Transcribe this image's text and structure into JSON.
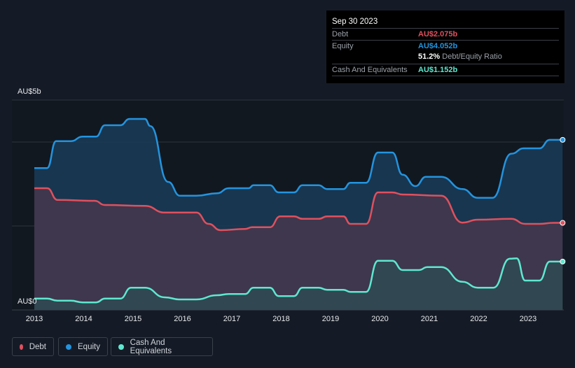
{
  "tooltip": {
    "date": "Sep 30 2023",
    "debt_label": "Debt",
    "debt_value": "AU$2.075b",
    "equity_label": "Equity",
    "equity_value": "AU$4.052b",
    "ratio_value": "51.2%",
    "ratio_label": "Debt/Equity Ratio",
    "cash_label": "Cash And Equivalents",
    "cash_value": "AU$1.152b"
  },
  "legend": [
    {
      "label": "Debt",
      "color": "#e0505e"
    },
    {
      "label": "Equity",
      "color": "#2394df"
    },
    {
      "label": "Cash And Equivalents",
      "color": "#5ee8d0"
    }
  ],
  "chart_data": {
    "type": "area",
    "ylim": [
      0,
      5
    ],
    "y_tick_labels": [
      "AU$0",
      "AU$5b"
    ],
    "x_tick_labels": [
      "2013",
      "2014",
      "2015",
      "2016",
      "2017",
      "2018",
      "2019",
      "2020",
      "2021",
      "2022",
      "2023"
    ],
    "xlim": [
      2013,
      2023.7
    ],
    "series": [
      {
        "name": "Equity",
        "color": "#2394df",
        "points": [
          [
            2013,
            3.38
          ],
          [
            2013.26,
            3.38
          ],
          [
            2013.44,
            4.02
          ],
          [
            2013.74,
            4.02
          ],
          [
            2013.98,
            4.13
          ],
          [
            2014.25,
            4.13
          ],
          [
            2014.43,
            4.4
          ],
          [
            2014.74,
            4.4
          ],
          [
            2014.93,
            4.55
          ],
          [
            2015.24,
            4.55
          ],
          [
            2015.35,
            4.38
          ],
          [
            2015.71,
            3.05
          ],
          [
            2015.95,
            2.72
          ],
          [
            2016.28,
            2.72
          ],
          [
            2016.7,
            2.78
          ],
          [
            2016.94,
            2.9
          ],
          [
            2017.34,
            2.9
          ],
          [
            2017.44,
            2.97
          ],
          [
            2017.77,
            2.97
          ],
          [
            2017.95,
            2.8
          ],
          [
            2018.26,
            2.8
          ],
          [
            2018.43,
            2.97
          ],
          [
            2018.76,
            2.97
          ],
          [
            2018.93,
            2.88
          ],
          [
            2019.26,
            2.88
          ],
          [
            2019.4,
            3.03
          ],
          [
            2019.72,
            3.03
          ],
          [
            2019.96,
            3.75
          ],
          [
            2020.25,
            3.75
          ],
          [
            2020.46,
            3.22
          ],
          [
            2020.72,
            2.95
          ],
          [
            2020.93,
            3.17
          ],
          [
            2021.24,
            3.17
          ],
          [
            2021.67,
            2.88
          ],
          [
            2021.98,
            2.67
          ],
          [
            2022.28,
            2.67
          ],
          [
            2022.66,
            3.72
          ],
          [
            2022.91,
            3.85
          ],
          [
            2023.23,
            3.85
          ],
          [
            2023.44,
            4.052
          ],
          [
            2023.7,
            4.052
          ]
        ]
      },
      {
        "name": "Debt",
        "color": "#e0505e",
        "points": [
          [
            2013,
            2.9
          ],
          [
            2013.26,
            2.9
          ],
          [
            2013.47,
            2.62
          ],
          [
            2014.22,
            2.6
          ],
          [
            2014.43,
            2.5
          ],
          [
            2015.24,
            2.48
          ],
          [
            2015.64,
            2.32
          ],
          [
            2016.28,
            2.32
          ],
          [
            2016.53,
            2.05
          ],
          [
            2016.77,
            1.9
          ],
          [
            2017.27,
            1.93
          ],
          [
            2017.41,
            1.97
          ],
          [
            2017.77,
            1.97
          ],
          [
            2017.98,
            2.23
          ],
          [
            2018.26,
            2.23
          ],
          [
            2018.43,
            2.17
          ],
          [
            2018.76,
            2.17
          ],
          [
            2018.93,
            2.23
          ],
          [
            2019.26,
            2.23
          ],
          [
            2019.4,
            2.05
          ],
          [
            2019.72,
            2.05
          ],
          [
            2019.96,
            2.8
          ],
          [
            2020.25,
            2.8
          ],
          [
            2020.46,
            2.75
          ],
          [
            2021.24,
            2.72
          ],
          [
            2021.67,
            2.08
          ],
          [
            2021.98,
            2.15
          ],
          [
            2022.66,
            2.17
          ],
          [
            2022.94,
            2.05
          ],
          [
            2023.23,
            2.05
          ],
          [
            2023.51,
            2.075
          ],
          [
            2023.7,
            2.075
          ]
        ]
      },
      {
        "name": "Cash And Equivalents",
        "color": "#5ee8d0",
        "points": [
          [
            2013,
            0.27
          ],
          [
            2013.26,
            0.27
          ],
          [
            2013.47,
            0.22
          ],
          [
            2013.74,
            0.22
          ],
          [
            2013.98,
            0.18
          ],
          [
            2014.25,
            0.18
          ],
          [
            2014.43,
            0.27
          ],
          [
            2014.74,
            0.27
          ],
          [
            2014.96,
            0.53
          ],
          [
            2015.24,
            0.53
          ],
          [
            2015.64,
            0.3
          ],
          [
            2015.95,
            0.25
          ],
          [
            2016.28,
            0.25
          ],
          [
            2016.7,
            0.35
          ],
          [
            2016.94,
            0.38
          ],
          [
            2017.27,
            0.38
          ],
          [
            2017.44,
            0.53
          ],
          [
            2017.77,
            0.53
          ],
          [
            2017.95,
            0.33
          ],
          [
            2018.26,
            0.33
          ],
          [
            2018.43,
            0.53
          ],
          [
            2018.76,
            0.53
          ],
          [
            2018.93,
            0.48
          ],
          [
            2019.26,
            0.48
          ],
          [
            2019.4,
            0.43
          ],
          [
            2019.72,
            0.43
          ],
          [
            2019.96,
            1.17
          ],
          [
            2020.25,
            1.17
          ],
          [
            2020.46,
            0.95
          ],
          [
            2020.79,
            0.95
          ],
          [
            2020.96,
            1.02
          ],
          [
            2021.24,
            1.02
          ],
          [
            2021.67,
            0.67
          ],
          [
            2021.98,
            0.53
          ],
          [
            2022.3,
            0.53
          ],
          [
            2022.63,
            1.22
          ],
          [
            2022.77,
            1.23
          ],
          [
            2022.94,
            0.7
          ],
          [
            2023.23,
            0.7
          ],
          [
            2023.44,
            1.152
          ],
          [
            2023.7,
            1.152
          ]
        ]
      }
    ]
  }
}
